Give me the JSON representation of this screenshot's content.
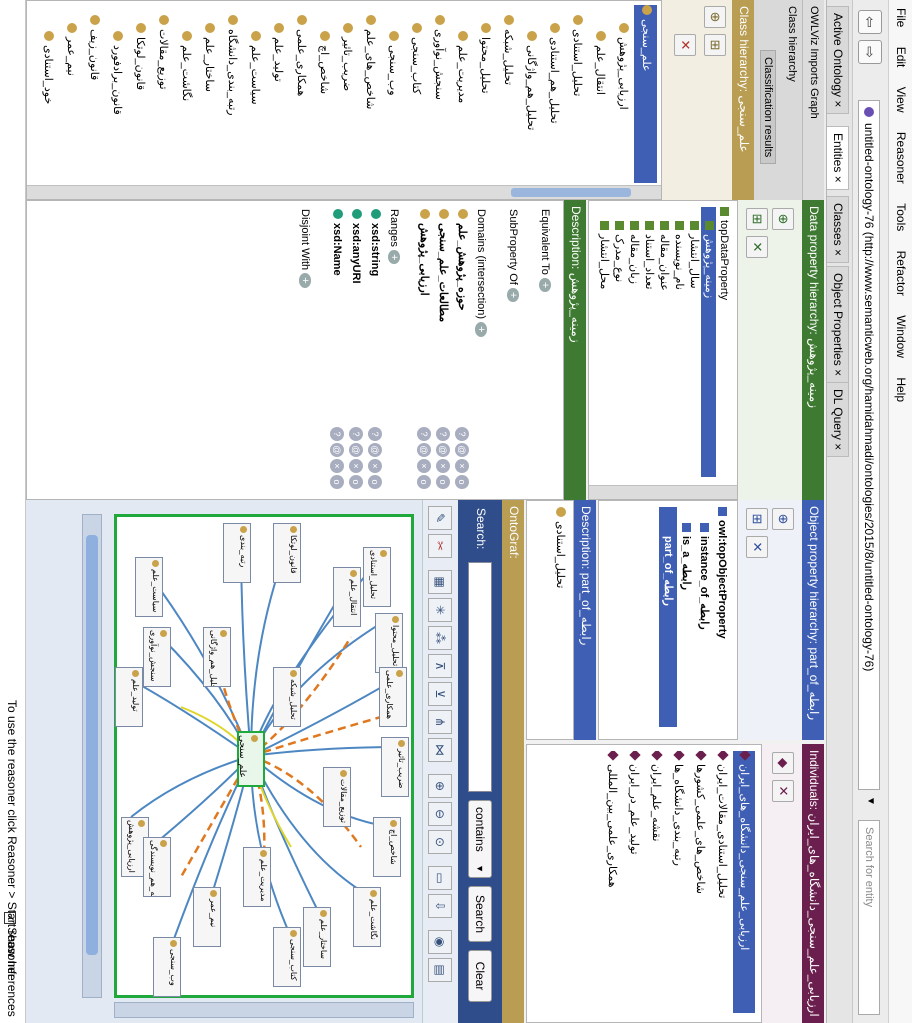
{
  "menu": [
    "File",
    "Edit",
    "View",
    "Reasoner",
    "Tools",
    "Refactor",
    "Window",
    "Help"
  ],
  "nav": {
    "ontology_iri": "untitled-ontology-76 (http://www.semanticweb.org/hamidahmadi/ontologies/2015/8/untitled-ontology-76)",
    "search_placeholder": "Search for entity"
  },
  "tabs": [
    {
      "label": "Active Ontology",
      "close": "×"
    },
    {
      "label": "Entities",
      "close": "×"
    },
    {
      "label": "Classes",
      "close": "×"
    },
    {
      "label": "Object Properties",
      "close": "×"
    },
    {
      "label": "DL Query",
      "close": "×"
    }
  ],
  "left": {
    "subtabs": [
      "OWLViz",
      "Imports Graph"
    ],
    "subtabs2": [
      "Class hierarchy",
      "Classification results"
    ],
    "class_header": "Class hierarchy: علم_سنجی",
    "tree": [
      "علم_سنجی",
      "ارزیابی_پژوهش",
      "انتقال_علم",
      "تحلیل_استنادی",
      "تحلیل_هم_استنادی",
      "تحلیل_هم_واژگانی",
      "تحلیل_شبکه",
      "تحلیل_محتوا",
      "مدیریت_علم",
      "سنجش_نوآوری",
      "کتاب_سنجی",
      "وب_سنجی",
      "شاخص_های_علم",
      "ضریب_تاثیر",
      "شاخص_اچ",
      "همکاری_علمی",
      "تولید_علم",
      "سیاست_علم",
      "رتبه_بندی_دانشگاه",
      "ساختار_علم",
      "نگاشت_علم",
      "توزیع_مقالات",
      "قانون_لوتکا",
      "قانون_برادفورد",
      "قانون_زیف",
      "نیم_عمر",
      "خود_استنادی"
    ]
  },
  "dataprop": {
    "header": "Data property hierarchy: زمینه_پژوهش",
    "items": [
      "topDataProperty",
      "زمینه_پژوهش",
      "سال_انتشار",
      "نام_نویسنده",
      "عنوان_مقاله",
      "تعداد_استناد",
      "زبان_مقاله",
      "نوع_مدرک",
      "محل_انتشار"
    ],
    "description_header": "Description: زمینه_پژوهش",
    "equivalent_to": "Equivalent To",
    "subproperty_of": "SubProperty Of",
    "domains": "Domains (intersection)",
    "domain_items": [
      "حوزه_پژوهش_علم",
      "مطالعات_علم_سنجی",
      "ارزیابی_پژوهش"
    ],
    "ranges": "Ranges",
    "range_items": [
      "xsd:string",
      "xsd:anyURI",
      "xsd:Name"
    ],
    "disjoint_with": "Disjoint With"
  },
  "objprop": {
    "header": "Object property hierarchy: part_of_رابطه",
    "items": [
      "owl:topObjectProperty",
      "instance_of_رابطه",
      "is_a_رابطه",
      "part_of_رابطه"
    ],
    "description_header": "Description: part_of_رابطه",
    "desc_item": "تحلیل_استنادی"
  },
  "individuals": {
    "header": "Individuals: ارزیابی_علم_سنجی_دانشگاه_های_ایران",
    "items": [
      "ارزیابی_علم_سنجی_دانشگاه_های_ایران",
      "تحلیل_استنادی_مقالات_ایران",
      "شاخص_های_علمی_کشورها",
      "رتبه_بندی_دانشگاه_ها",
      "نقشه_علم_ایران",
      "تولید_علم_در_ایران",
      "همکاری_علمی_بین_المللی"
    ]
  },
  "ontograf": {
    "header": "OntoGraf:",
    "search_label": "Search:",
    "match_mode": "contains",
    "search_button": "Search",
    "clear_button": "Clear",
    "center_node": "علم_سنجی",
    "nodes": [
      "تحلیل_استنادی",
      "تحلیل_محتوا",
      "همکاری_علمی",
      "ضریب_تاثیر",
      "شاخص_اچ",
      "نگاشت_علم",
      "کتاب_سنجی",
      "وب_سنجی",
      "ارزیابی_پژوهش",
      "تولید_علم",
      "سیاست_علم",
      "رتبه_بندی",
      "قانون_لوتکا",
      "انتقال_علم",
      "ساختار_علم",
      "نیم_عمر",
      "سنجش_نوآوری",
      "شبکه_هم_نویسندگی",
      "تحلیل_هم_واژگانی",
      "توزیع_مقالات",
      "مدیریت_علم",
      "تحلیل_شبکه"
    ]
  },
  "status": {
    "message": "To use the reasoner click Reasoner > Start reasoner",
    "show_inferences": "Show Inferences"
  }
}
